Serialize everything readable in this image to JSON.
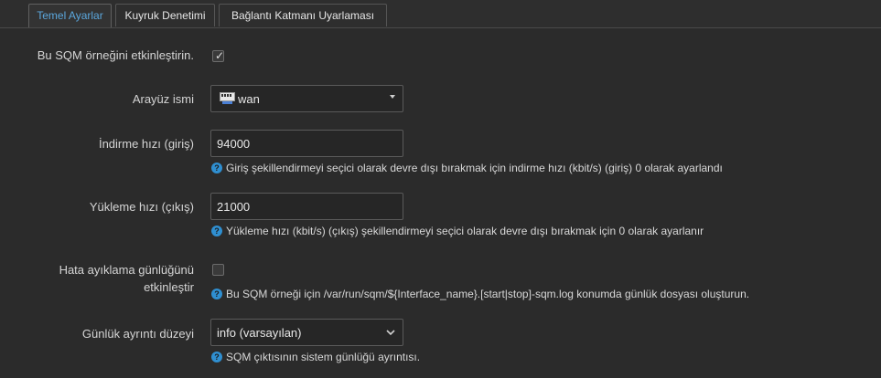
{
  "tabs": [
    {
      "label": "Temel Ayarlar"
    },
    {
      "label": "Kuyruk Denetimi"
    },
    {
      "label": "Bağlantı Katmanı Uyarlaması"
    }
  ],
  "form": {
    "enable": {
      "label": "Bu SQM örneğini etkinleştirin.",
      "checked": true
    },
    "interface": {
      "label": "Arayüz ismi",
      "value": "wan",
      "icon": "network-port-icon"
    },
    "download": {
      "label": "İndirme hızı (giriş)",
      "value": "94000",
      "hint": "Giriş şekillendirmeyi seçici olarak devre dışı bırakmak için indirme hızı (kbit/s) (giriş) 0 olarak ayarlandı"
    },
    "upload": {
      "label": "Yükleme hızı (çıkış)",
      "value": "21000",
      "hint": "Yükleme hızı (kbit/s) (çıkış) şekillendirmeyi seçici olarak devre dışı bırakmak için 0 olarak ayarlanır"
    },
    "debug": {
      "label_line1": "Hata ayıklama günlüğünü",
      "label_line2": "etkinleştir",
      "checked": false,
      "hint": "Bu SQM örneği için /var/run/sqm/${Interface_name}.[start|stop]-sqm.log konumda günlük dosyası oluşturun."
    },
    "verbosity": {
      "label": "Günlük ayrıntı düzeyi",
      "value": "info (varsayılan)",
      "hint": "SQM çıktısının sistem günlüğü ayrıntısı."
    }
  },
  "colors": {
    "background": "#2b2b2b",
    "active_tab": "#5ba7dd",
    "help_icon": "#2f8fd1"
  }
}
